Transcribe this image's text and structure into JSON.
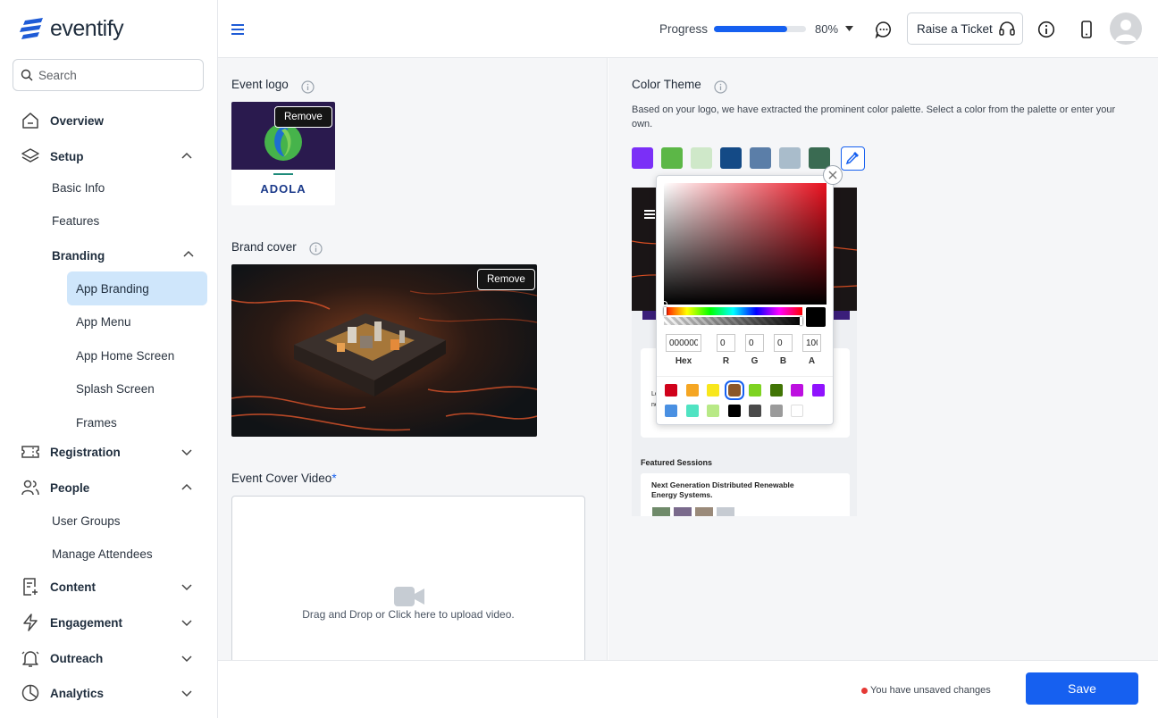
{
  "app": {
    "name": "eventify"
  },
  "search": {
    "placeholder": "Search"
  },
  "sidebar": {
    "overview": "Overview",
    "setup": "Setup",
    "setup_items": [
      "Basic Info",
      "Features"
    ],
    "branding": "Branding",
    "branding_items": [
      "App Branding",
      "App Menu",
      "App Home Screen",
      "Splash Screen",
      "Frames"
    ],
    "registration": "Registration",
    "people": "People",
    "people_items": [
      "User Groups",
      "Manage Attendees"
    ],
    "content": "Content",
    "engagement": "Engagement",
    "outreach": "Outreach",
    "analytics": "Analytics"
  },
  "header": {
    "progress_label": "Progress",
    "progress_value": 80,
    "progress_text": "80%",
    "raise_ticket": "Raise a Ticket"
  },
  "left": {
    "event_logo_title": "Event logo",
    "remove_label": "Remove",
    "logo_text": "ADOLA",
    "brand_cover_title": "Brand cover",
    "video_title": "Event Cover Video",
    "video_required": "*",
    "video_hint": "Drag and Drop or Click here to upload video."
  },
  "right": {
    "color_theme_title": "Color Theme",
    "description": "Based on your logo, we have extracted the prominent color palette. Select a color from the palette or enter your own.",
    "palette": [
      "#7b2ff7",
      "#5cb747",
      "#cfe8c9",
      "#144a86",
      "#5b7ea8",
      "#a9bccb",
      "#3a6b52"
    ],
    "preview": {
      "featured_title": "Featured Sessions",
      "session_title": "Next Generation Distributed Renewable Energy Systems.",
      "card_fragment": "Lo",
      "card_fragment2": "ne"
    }
  },
  "picker": {
    "hex": "000000",
    "r": "0",
    "g": "0",
    "b": "0",
    "a": "100",
    "labels": {
      "hex": "Hex",
      "r": "R",
      "g": "G",
      "b": "B",
      "a": "A"
    },
    "presets": [
      "#d0021b",
      "#f5a623",
      "#f8e71c",
      "#8b572a",
      "#7ed321",
      "#417505",
      "#bd10e0",
      "#9013fe",
      "#4a90e2",
      "#50e3c2",
      "#b8e986",
      "#000000",
      "#4a4a4a",
      "#9b9b9b",
      "#ffffff"
    ],
    "selected_preset": "#8b572a"
  },
  "footer": {
    "unsaved": "You have unsaved changes",
    "save": "Save"
  }
}
